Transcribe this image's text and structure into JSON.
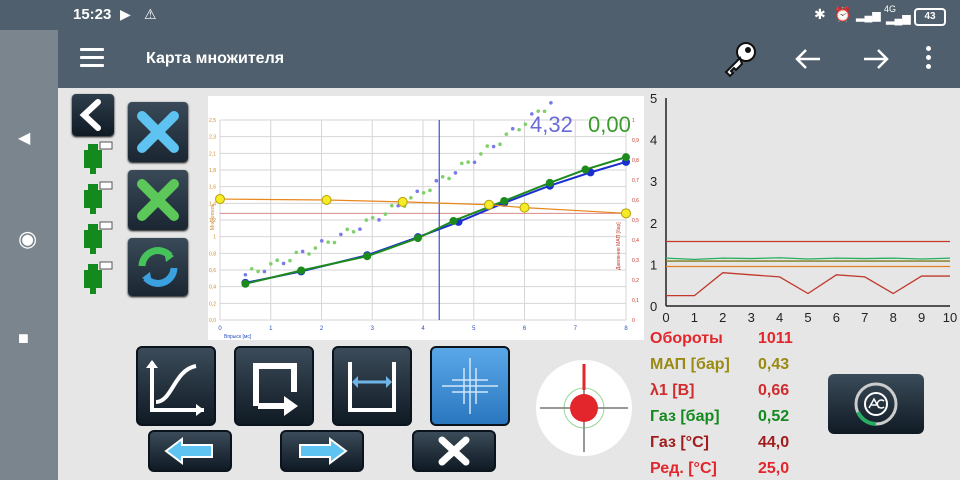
{
  "status": {
    "time": "15:23",
    "battery": "43",
    "network": "4G"
  },
  "app": {
    "title": "Карта множителя"
  },
  "chart_display": {
    "value_blue": "4,32",
    "value_green": "0,00",
    "x_axis_label": "Впрыск [мс]",
    "y_axis_label": "Множитель",
    "y2_axis_label": "Давление МАП [бар]"
  },
  "chart_data": [
    {
      "type": "scatter",
      "xlabel": "Впрыск [мс]",
      "ylabel": "Множитель",
      "y2label": "Давление МАП [бар]",
      "xlim": [
        0,
        8
      ],
      "ylim": [
        0,
        2.1
      ],
      "y2lim": [
        0,
        1.0
      ],
      "x_ticks": [
        "0",
        "1",
        "2",
        "3",
        "4",
        "5",
        "6",
        "7",
        "8"
      ],
      "y_ticks": [
        "0,0",
        "0,2",
        "0,4",
        "0,6",
        "0,8",
        "1",
        "1,2",
        "1,4",
        "1,6",
        "1,8",
        "2,1",
        "2,3",
        "2,5"
      ],
      "y2_ticks": [
        "0",
        "0,1",
        "0,2",
        "0,3",
        "0,4",
        "0,5",
        "0,6",
        "0,7",
        "0,8",
        "0,9",
        "1"
      ],
      "cursor_x": 4.32,
      "series": [
        {
          "values": [
            [
              0.5,
              0.39
            ],
            [
              1.6,
              0.51
            ],
            [
              2.9,
              0.68
            ],
            [
              3.9,
              0.87
            ],
            [
              4.7,
              1.03
            ],
            [
              5.6,
              1.23
            ],
            [
              6.5,
              1.41
            ],
            [
              7.3,
              1.55
            ],
            [
              8.0,
              1.66
            ]
          ]
        },
        {
          "values": [
            [
              0.5,
              0.38
            ],
            [
              1.6,
              0.52
            ],
            [
              2.9,
              0.67
            ],
            [
              3.9,
              0.86
            ],
            [
              4.6,
              1.04
            ],
            [
              5.6,
              1.25
            ],
            [
              6.5,
              1.44
            ],
            [
              7.2,
              1.58
            ],
            [
              8.0,
              1.71
            ]
          ]
        },
        {
          "values": [
            [
              0,
              1.27
            ],
            [
              2.1,
              1.26
            ],
            [
              3.6,
              1.24
            ],
            [
              5.3,
              1.21
            ],
            [
              6.0,
              1.18
            ],
            [
              8.0,
              1.12
            ]
          ]
        }
      ]
    },
    {
      "type": "line",
      "xlim": [
        0,
        10
      ],
      "ylim": [
        0,
        5
      ],
      "x_ticks": [
        "0",
        "1",
        "2",
        "3",
        "4",
        "5",
        "6",
        "7",
        "8",
        "9",
        "10"
      ],
      "y_ticks": [
        "0",
        "1",
        "2",
        "3",
        "4",
        "5"
      ],
      "series": [
        {
          "color": "#c0392b",
          "values": [
            1.55,
            1.55,
            1.55,
            1.55,
            1.55,
            1.55,
            1.55,
            1.55,
            1.55,
            1.55,
            1.55
          ]
        },
        {
          "color": "#27ae60",
          "values": [
            1.15,
            1.12,
            1.15,
            1.14,
            1.16,
            1.13,
            1.15,
            1.14,
            1.15,
            1.13,
            1.15
          ]
        },
        {
          "color": "#7f7a1a",
          "values": [
            1.08,
            1.08,
            1.08,
            1.08,
            1.08,
            1.08,
            1.08,
            1.08,
            1.08,
            1.08,
            1.08
          ]
        },
        {
          "color": "#e67e22",
          "values": [
            0.95,
            0.95,
            0.95,
            0.95,
            0.95,
            0.95,
            0.95,
            0.95,
            0.95,
            0.95,
            0.95
          ]
        },
        {
          "color": "#c0392b",
          "values": [
            0.25,
            0.25,
            0.8,
            0.75,
            0.7,
            0.3,
            0.75,
            0.7,
            0.3,
            0.72,
            0.72
          ]
        }
      ]
    }
  ],
  "readouts": [
    {
      "label": "Обороты",
      "value": "1011",
      "color": "#e3262b"
    },
    {
      "label": "МАП [бар]",
      "value": "0,43",
      "color": "#9a8a14"
    },
    {
      "label": "λ1 [В]",
      "value": "0,66",
      "color": "#cf2d2d"
    },
    {
      "label": "Газ [бар]",
      "value": "0,52",
      "color": "#148a1e"
    },
    {
      "label": "Газ [°C]",
      "value": "44,0",
      "color": "#a01d1d"
    },
    {
      "label": "Ред. [°C]",
      "value": "25,0",
      "color": "#e3262b"
    }
  ],
  "icons": {
    "menu": "hamburger-icon",
    "key": "key-icon",
    "back": "arrow-left-icon",
    "forward": "arrow-right-icon",
    "more": "more-vert-icon"
  }
}
